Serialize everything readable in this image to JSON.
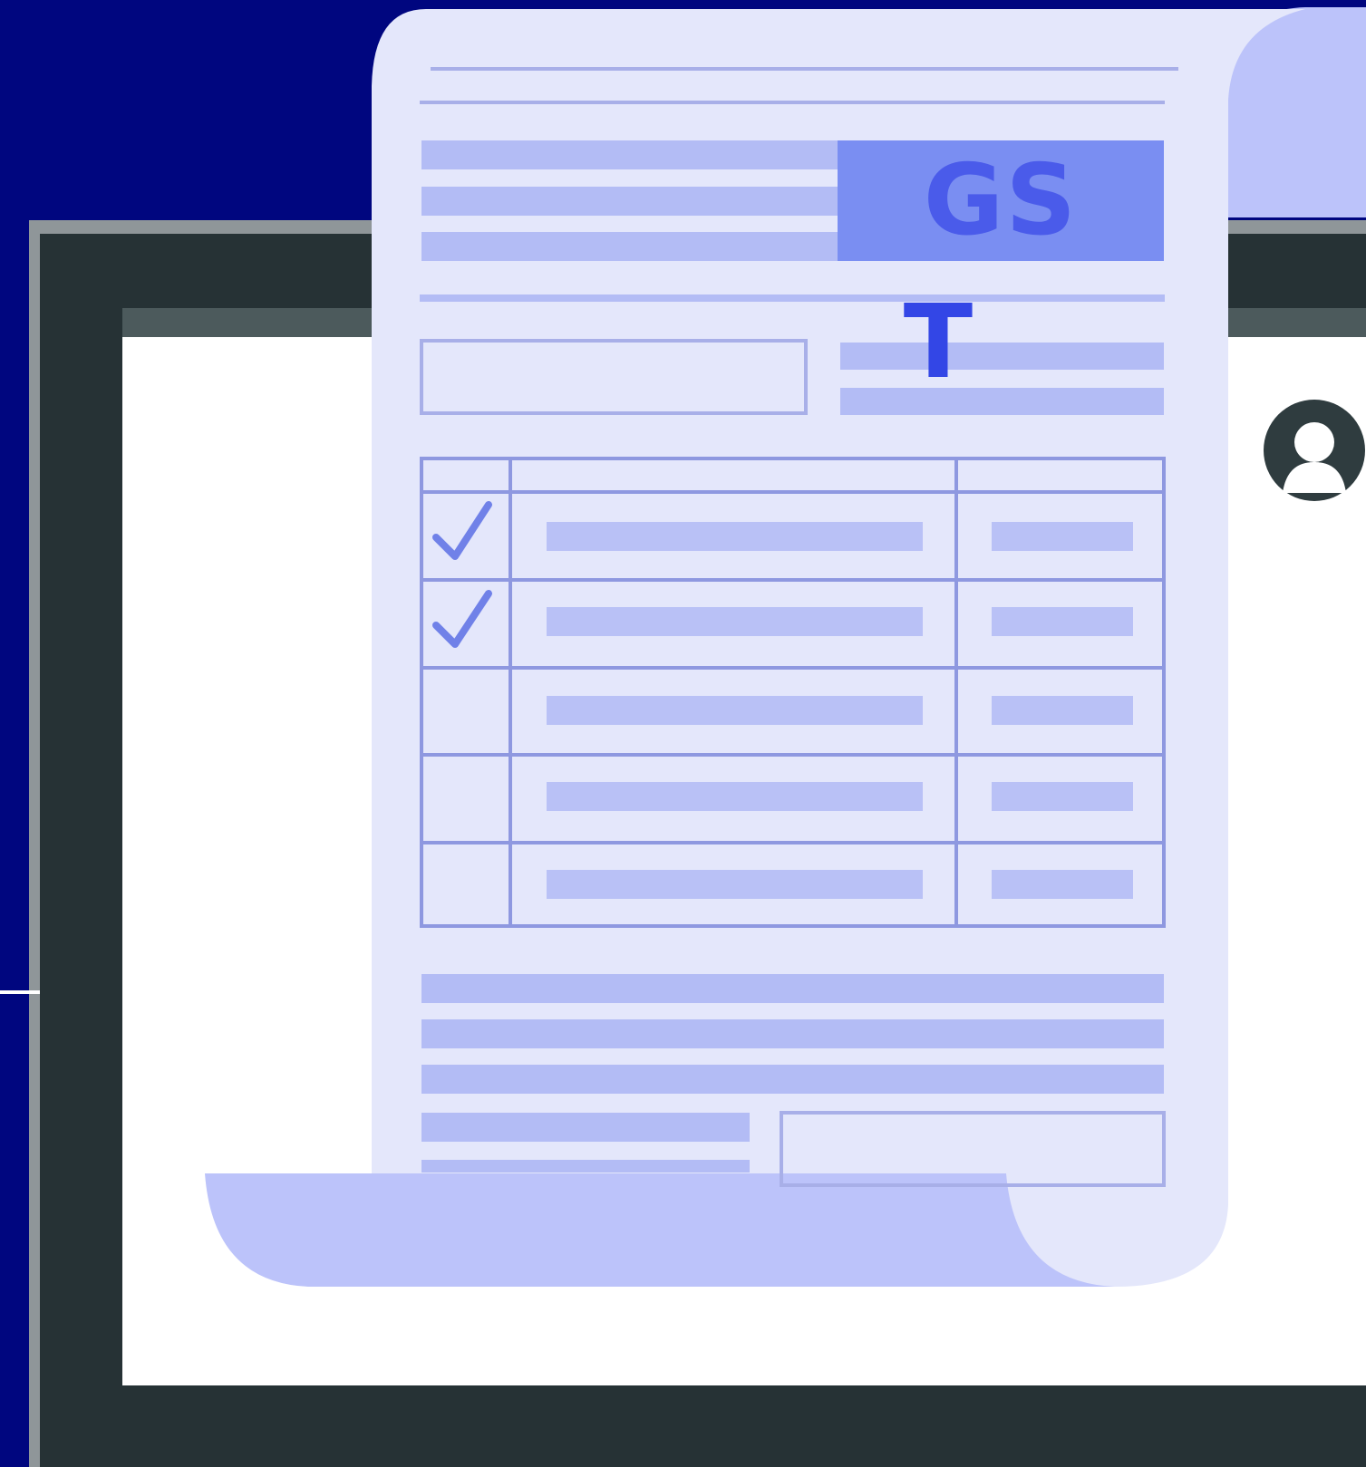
{
  "document": {
    "badge_top": "GS",
    "badge_bottom": "T",
    "checked_rows": [
      true,
      true,
      false,
      false,
      false
    ]
  },
  "colors": {
    "background": "#00067f",
    "paper": "#e4e7fb",
    "paper_fold": "#bcc3fa",
    "bar": "#b3bcf5",
    "badge": "#7a8ef2",
    "text_accent": "#4a5bea",
    "monitor": "#263235",
    "screen": "#ffffff"
  },
  "icons": [
    "user-avatar-icon",
    "checkmark-icon"
  ]
}
